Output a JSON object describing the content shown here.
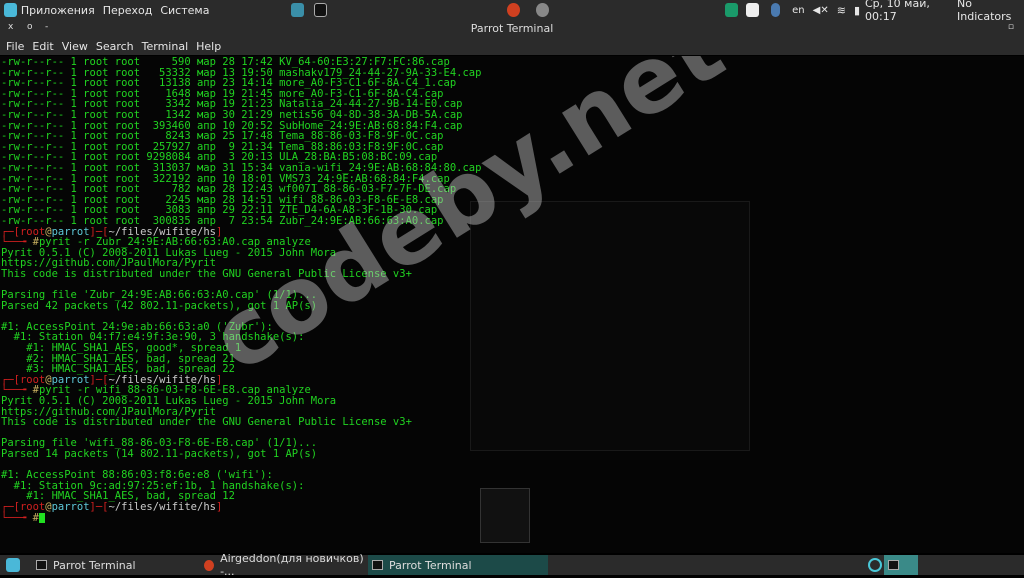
{
  "topbar": {
    "menus": [
      "Приложения",
      "Переход",
      "Система"
    ],
    "lang": "en",
    "clock": "Ср, 10 май, 00:17",
    "indicators": "No Indicators"
  },
  "window": {
    "title": "Parrot Terminal",
    "controls": [
      "x",
      "o",
      "-"
    ]
  },
  "menubar": [
    "File",
    "Edit",
    "View",
    "Search",
    "Terminal",
    "Help"
  ],
  "ls_lines": [
    "-rw-r--r-- 1 root root     590 мар 28 17:42 KV_64-60:E3:27:F7:FC:86.cap",
    "-rw-r--r-- 1 root root   53332 мар 13 19:50 mashakv179_24-44-27-9A-33-E4.cap",
    "-rw-r--r-- 1 root root   13138 апр 23 14:14 more_A0-F3-C1-6F-8A-C4_1.cap",
    "-rw-r--r-- 1 root root    1648 мар 19 21:45 more_A0-F3-C1-6F-8A-C4.cap",
    "-rw-r--r-- 1 root root    3342 мар 19 21:23 Natalia_24-44-27-9B-14-E0.cap",
    "-rw-r--r-- 1 root root    1342 мар 30 21:29 netis56_04-8D-38-3A-DB-5A.cap",
    "-rw-r--r-- 1 root root  393460 апр 10 20:52 SubHome_24:9E:AB:68:84:F4.cap",
    "-rw-r--r-- 1 root root    8243 мар 25 17:48 Tema_88-86-03-F8-9F-0C.cap",
    "-rw-r--r-- 1 root root  257927 апр  9 21:34 Tema_88:86:03:F8:9F:0C.cap",
    "-rw-r--r-- 1 root root 9298084 апр  3 20:13 ULA_28:BA:B5:08:BC:09.cap",
    "-rw-r--r-- 1 root root  313037 мар 31 15:34 vania-wifi_24:9E:AB:68:84:80.cap",
    "-rw-r--r-- 1 root root  322192 апр 10 18:01 VMS73_24:9E:AB:68:84:F4.cap",
    "-rw-r--r-- 1 root root     782 мар 28 12:43 wf0071_88-86-03-F7-7F-DE.cap",
    "-rw-r--r-- 1 root root    2245 мар 28 14:51 wifi_88-86-03-F8-6E-E8.cap",
    "-rw-r--r-- 1 root root    3083 апр 29 22:11 ZTE_D4-6A-A8-3F-1B-30.cap",
    "-rw-r--r-- 1 root root  300835 апр  7 23:54 Zubr_24:9E:AB:66:63:A0.cap"
  ],
  "prompt": {
    "user": "root",
    "host": "parrot",
    "path": "~/files/wifite/hs"
  },
  "cmd1": "pyrit -r Zubr_24:9E:AB:66:63:A0.cap analyze",
  "out1": [
    "Pyrit 0.5.1 (C) 2008-2011 Lukas Lueg - 2015 John Mora",
    "https://github.com/JPaulMora/Pyrit",
    "This code is distributed under the GNU General Public License v3+",
    "",
    "Parsing file 'Zubr_24:9E:AB:66:63:A0.cap' (1/1)...",
    "Parsed 42 packets (42 802.11-packets), got 1 AP(s)",
    "",
    "#1: AccessPoint 24:9e:ab:66:63:a0 ('Zubr'):",
    "  #1: Station 04:f7:e4:9f:3e:90, 3 handshake(s):",
    "    #1: HMAC_SHA1_AES, good*, spread 1",
    "    #2: HMAC_SHA1_AES, bad, spread 21",
    "    #3: HMAC_SHA1_AES, bad, spread 22"
  ],
  "cmd2": "pyrit -r wifi_88-86-03-F8-6E-E8.cap analyze",
  "out2": [
    "Pyrit 0.5.1 (C) 2008-2011 Lukas Lueg - 2015 John Mora",
    "https://github.com/JPaulMora/Pyrit",
    "This code is distributed under the GNU General Public License v3+",
    "",
    "Parsing file 'wifi_88-86-03-F8-6E-E8.cap' (1/1)...",
    "Parsed 14 packets (14 802.11-packets), got 1 AP(s)",
    "",
    "#1: AccessPoint 88:86:03:f8:6e:e8 ('wifi'):",
    "  #1: Station 9c:ad:97:25:ef:1b, 1 handshake(s):",
    "    #1: HMAC_SHA1_AES, bad, spread 12"
  ],
  "watermark": "codeby.net",
  "taskbar": {
    "tasks": [
      "Parrot Terminal",
      "Airgeddon(для новичков) -...",
      "Parrot Terminal"
    ]
  }
}
